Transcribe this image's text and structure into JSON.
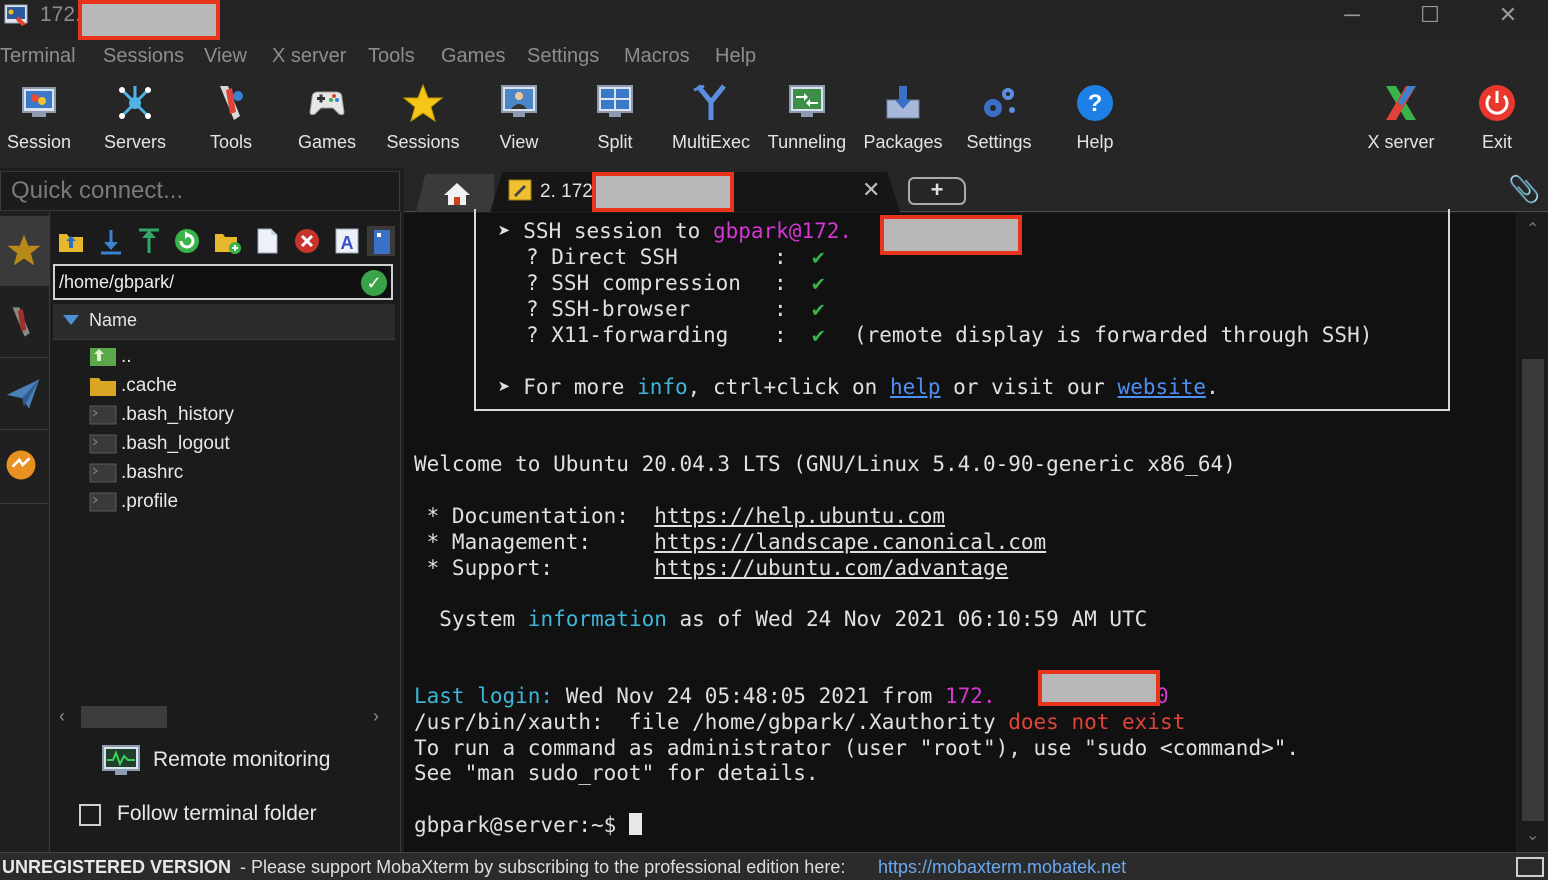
{
  "window": {
    "title_prefix": "172.",
    "minimize_glyph": "─",
    "maximize_glyph": "☐",
    "close_glyph": "✕"
  },
  "menu": [
    "Terminal",
    "Sessions",
    "View",
    "X server",
    "Tools",
    "Games",
    "Settings",
    "Macros",
    "Help"
  ],
  "toolbar": {
    "session": "Session",
    "servers": "Servers",
    "tools": "Tools",
    "games": "Games",
    "sessions": "Sessions",
    "view": "View",
    "split": "Split",
    "multiexec": "MultiExec",
    "tunneling": "Tunneling",
    "packages": "Packages",
    "settings": "Settings",
    "help": "Help",
    "xserver": "X server",
    "exit": "Exit"
  },
  "quick_connect": {
    "placeholder": "Quick connect..."
  },
  "tabs": {
    "active_label": "2. 172",
    "close_glyph": "✕",
    "new_glyph": "+"
  },
  "file_browser": {
    "path": "/home/gbpark/",
    "column_name": "Name",
    "files": [
      "..",
      ".cache",
      ".bash_history",
      ".bash_logout",
      ".bashrc",
      ".profile"
    ],
    "remote_monitoring": "Remote monitoring",
    "follow_terminal_folder": "Follow terminal folder",
    "follow_checked": false
  },
  "terminal": {
    "ssh_session_prefix": "➤ SSH session to ",
    "ssh_user": "gbpark@172.",
    "features": [
      {
        "name": "? Direct SSH",
        "sep": ":",
        "check": "✔",
        "note": ""
      },
      {
        "name": "? SSH compression",
        "sep": ":",
        "check": "✔",
        "note": ""
      },
      {
        "name": "? SSH-browser",
        "sep": ":",
        "check": "✔",
        "note": ""
      },
      {
        "name": "? X11-forwarding",
        "sep": ":",
        "check": "✔",
        "note": "(remote display is forwarded through SSH)"
      }
    ],
    "more_info": {
      "prefix": "➤ For more ",
      "info": "info",
      "mid": ", ctrl+click on ",
      "help": "help",
      "or": " or visit our ",
      "website": "website",
      "end": "."
    },
    "welcome": "Welcome to Ubuntu 20.04.3 LTS (GNU/Linux 5.4.0-90-generic x86_64)",
    "links": [
      {
        "label": " * Documentation:  ",
        "url": "https://help.ubuntu.com"
      },
      {
        "label": " * Management:     ",
        "url": "https://landscape.canonical.com"
      },
      {
        "label": " * Support:        ",
        "url": "https://ubuntu.com/advantage"
      }
    ],
    "sysinfo": {
      "prefix": "  System ",
      "word": "information",
      "rest": " as of Wed 24 Nov 2021 06:10:59 AM UTC"
    },
    "last_login": {
      "label": "Last login:",
      "text": " Wed Nov 24 05:48:05 2021 from ",
      "ip": "172.",
      "ip_tail": "0"
    },
    "xauth": {
      "prefix": "/usr/bin/xauth:  file /home/gbpark/.Xauthority ",
      "error": "does not exist"
    },
    "sudo_line1": "To run a command as administrator (user \"root\"), use \"sudo <command>\".",
    "sudo_line2": "See \"man sudo_root\" for details.",
    "prompt": "gbpark@server:~$ "
  },
  "statusbar": {
    "unregistered": "UNREGISTERED VERSION",
    "message": " -  Please support MobaXterm by subscribing to the professional edition here:",
    "link": "https://mobaxterm.mobatek.net"
  },
  "colors": {
    "accent_red": "#e8341c",
    "terminal_magenta": "#d437d4",
    "terminal_cyan": "#3db6d8",
    "terminal_green": "#3ab34a",
    "terminal_red": "#e0443c"
  }
}
